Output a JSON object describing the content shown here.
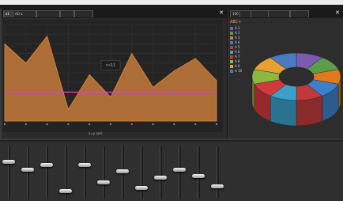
{
  "left_panel": {
    "tabs": [
      "a1",
      "AD a",
      "",
      "",
      ""
    ],
    "x_axis_label": "x=y axis",
    "tooltip": "v=2,1"
  },
  "right_panel": {
    "tabs": [
      "100",
      "",
      "",
      "",
      ""
    ],
    "legend_title": "ABC+",
    "legend_items": [
      "A 1",
      "A 2",
      "A 3",
      "A 4",
      "A 5",
      "A 6",
      "A 7",
      "A 8",
      "A 9",
      "A 10"
    ]
  },
  "colors": {
    "area_fill": "#c47a3a",
    "area_line": "#e08a3a",
    "threshold_line": "#e040c0",
    "pie": [
      "#7a5bb0",
      "#5a9e4a",
      "#e07a1e",
      "#3d7fc8",
      "#c03a3a",
      "#3aa0c8",
      "#d03a3a",
      "#8ab840",
      "#e8a030",
      "#4a7ac0"
    ]
  },
  "chart_data": {
    "type": "area",
    "x": [
      0,
      1,
      2,
      3,
      4,
      5,
      6,
      7,
      8,
      9,
      10
    ],
    "values": [
      80,
      60,
      88,
      12,
      48,
      25,
      70,
      35,
      52,
      65,
      42
    ],
    "ylim": [
      0,
      100
    ],
    "threshold": 30
  },
  "pie_data": {
    "type": "pie",
    "values": [
      10,
      10,
      10,
      10,
      10,
      10,
      10,
      10,
      10,
      10
    ]
  },
  "faders": {
    "levels": [
      0.72,
      0.55,
      0.66,
      0.12,
      0.66,
      0.3,
      0.52,
      0.18,
      0.4,
      0.55,
      0.42,
      0.22
    ]
  }
}
